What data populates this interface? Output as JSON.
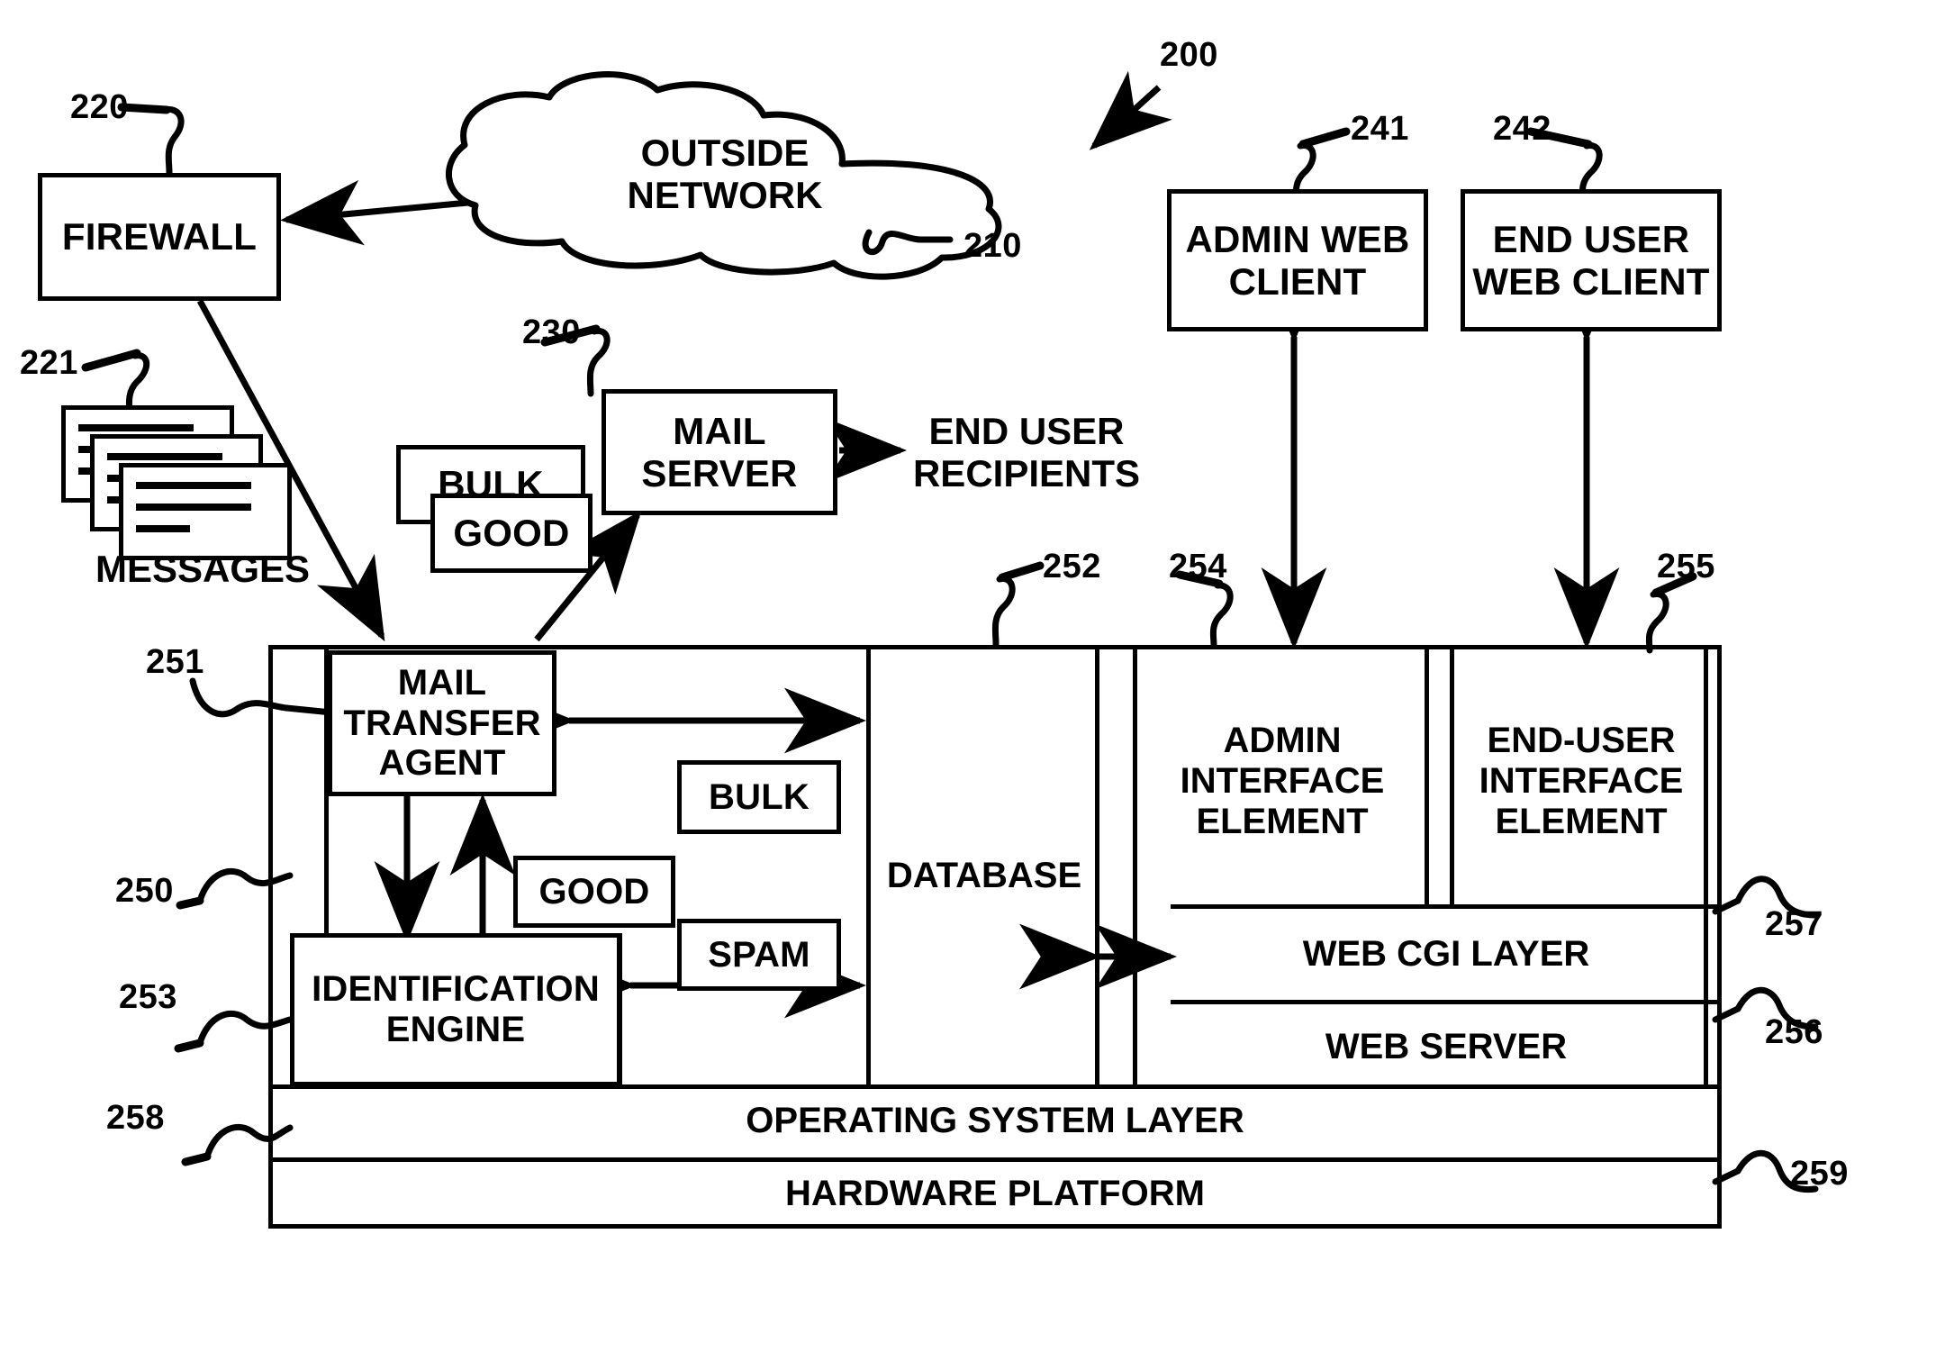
{
  "figure": {
    "title_ref": "200"
  },
  "nodes": {
    "outside_network": {
      "label": "OUTSIDE\nNETWORK",
      "ref": "210"
    },
    "firewall": {
      "label": "FIREWALL",
      "ref": "220"
    },
    "messages": {
      "label": "MESSAGES",
      "ref": "221"
    },
    "mail_server": {
      "label": "MAIL\nSERVER",
      "ref": "230"
    },
    "end_user_recipients": {
      "label": "END USER\nRECIPIENTS"
    },
    "admin_web_client": {
      "label": "ADMIN\nWEB CLIENT",
      "ref": "241"
    },
    "end_user_web_client": {
      "label": "END USER\nWEB CLIENT",
      "ref": "242"
    },
    "bulk_out": {
      "label": "BULK"
    },
    "good_out": {
      "label": "GOOD"
    },
    "system": {
      "ref": "250"
    },
    "mail_transfer_agent": {
      "label": "MAIL\nTRANSFER\nAGENT",
      "ref": "251"
    },
    "database": {
      "label": "DATABASE",
      "ref": "252"
    },
    "identification_engine": {
      "label": "IDENTIFICATION\nENGINE",
      "ref": "253"
    },
    "admin_interface_element": {
      "label": "ADMIN\nINTERFACE\nELEMENT",
      "ref": "254"
    },
    "end_user_interface_element": {
      "label": "END-USER\nINTERFACE\nELEMENT",
      "ref": "255"
    },
    "web_server": {
      "label": "WEB SERVER",
      "ref": "256"
    },
    "web_cgi_layer": {
      "label": "WEB CGI LAYER",
      "ref": "257"
    },
    "operating_system_layer": {
      "label": "OPERATING SYSTEM LAYER",
      "ref": "258"
    },
    "hardware_platform": {
      "label": "HARDWARE PLATFORM",
      "ref": "259"
    },
    "bulk_inner": {
      "label": "BULK"
    },
    "good_inner": {
      "label": "GOOD"
    },
    "spam_inner": {
      "label": "SPAM"
    }
  },
  "colors": {
    "ink": "#000000",
    "paper": "#ffffff"
  }
}
